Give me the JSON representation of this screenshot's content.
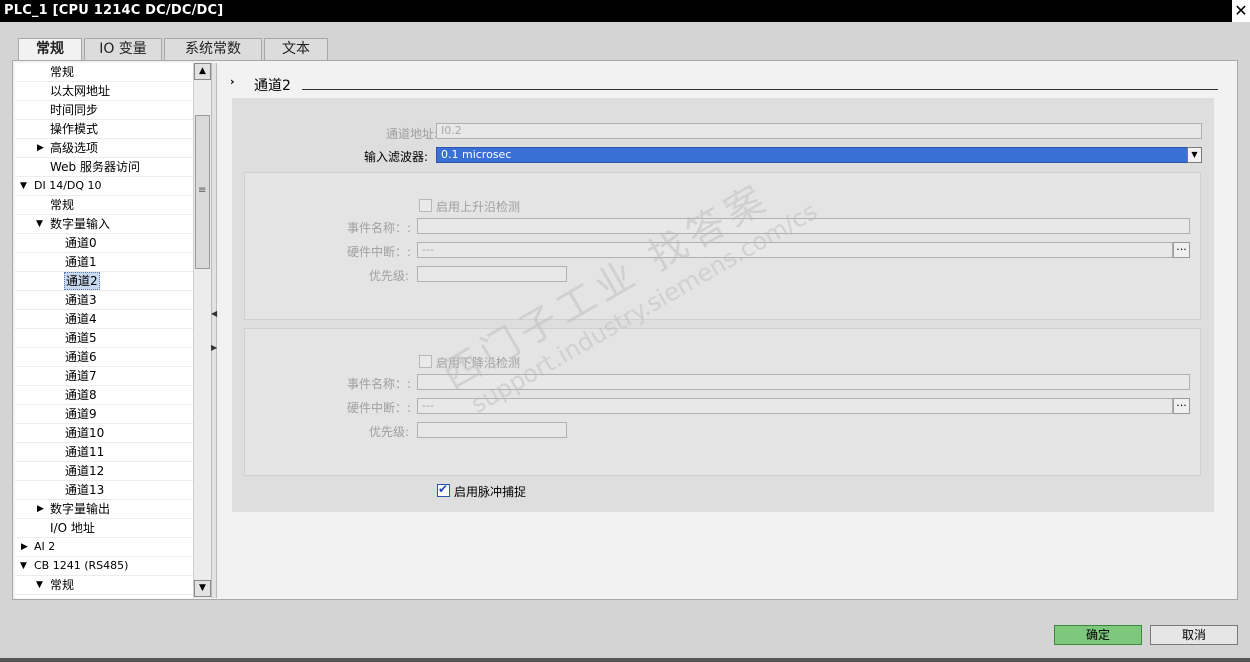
{
  "window": {
    "title": "PLC_1 [CPU 1214C DC/DC/DC]",
    "close_glyph": "✕"
  },
  "tabs": [
    {
      "label": "常规"
    },
    {
      "label": "IO 变量"
    },
    {
      "label": "系统常数"
    },
    {
      "label": "文本"
    }
  ],
  "tree": [
    {
      "label": "常规"
    },
    {
      "label": "以太网地址"
    },
    {
      "label": "时间同步"
    },
    {
      "label": "操作模式"
    },
    {
      "label": "高级选项"
    },
    {
      "label": "Web 服务器访问"
    },
    {
      "label": "DI 14/DQ 10"
    },
    {
      "label": "常规"
    },
    {
      "label": "数字量输入"
    },
    {
      "label": "通道0"
    },
    {
      "label": "通道1"
    },
    {
      "label": "通道2"
    },
    {
      "label": "通道3"
    },
    {
      "label": "通道4"
    },
    {
      "label": "通道5"
    },
    {
      "label": "通道6"
    },
    {
      "label": "通道7"
    },
    {
      "label": "通道8"
    },
    {
      "label": "通道9"
    },
    {
      "label": "通道10"
    },
    {
      "label": "通道11"
    },
    {
      "label": "通道12"
    },
    {
      "label": "通道13"
    },
    {
      "label": "数字量输出"
    },
    {
      "label": "I/O 地址"
    },
    {
      "label": "AI 2"
    },
    {
      "label": "CB 1241 (RS485)"
    },
    {
      "label": "常规"
    }
  ],
  "section": {
    "caret": "›",
    "title": "通道2"
  },
  "form": {
    "channel_address_label": "通道地址:",
    "channel_address_value": "I0.2",
    "input_filter_label": "输入滤波器:",
    "input_filter_value": "0.1 microsec",
    "rising": {
      "checkbox_label": "启用上升沿检测",
      "event_name_label": "事件名称：:",
      "event_name_value": "",
      "hw_interrupt_label": "硬件中断：:",
      "hw_interrupt_value": "---",
      "priority_label": "优先级:",
      "priority_value": ""
    },
    "falling": {
      "checkbox_label": "启用下降沿检测",
      "event_name_label": "事件名称：:",
      "event_name_value": "",
      "hw_interrupt_label": "硬件中断：:",
      "hw_interrupt_value": "---",
      "priority_label": "优先级:",
      "priority_value": ""
    },
    "pulse_catch_label": "启用脉冲捕捉",
    "pulse_catch_checked": true
  },
  "watermark": {
    "line1": "西门子工业  找答案",
    "line2": "support.industry.siemens.com/cs"
  },
  "buttons": {
    "ok": "确定",
    "cancel": "取消"
  },
  "colors": {
    "accent_blue": "#3a6fd6",
    "ok_green": "#7ec87e",
    "titlebar": "#000000"
  }
}
